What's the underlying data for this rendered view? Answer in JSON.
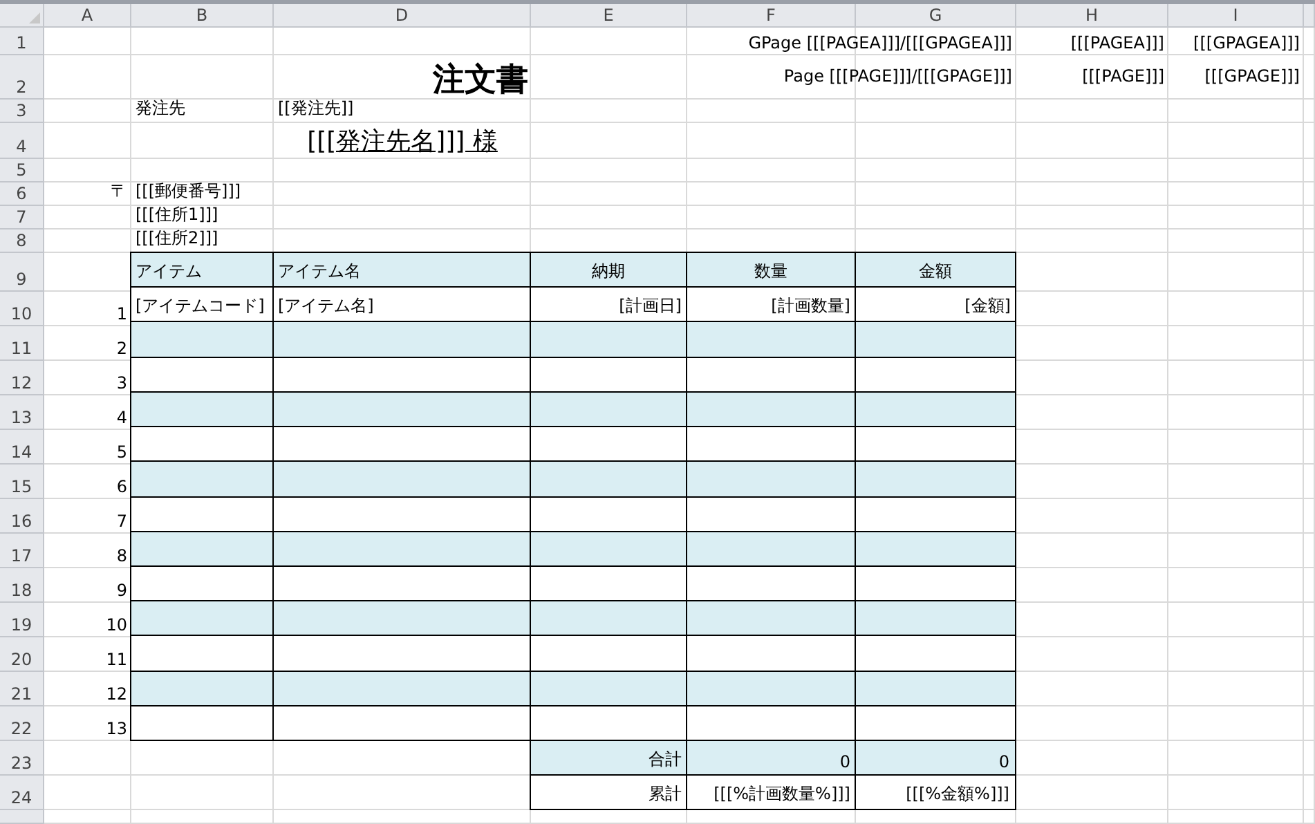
{
  "column_headers": [
    "A",
    "B",
    "D",
    "E",
    "F",
    "G",
    "H",
    "I"
  ],
  "row_numbers": [
    "1",
    "2",
    "3",
    "4",
    "5",
    "6",
    "7",
    "8",
    "9",
    "10",
    "11",
    "12",
    "13",
    "14",
    "15",
    "16",
    "17",
    "18",
    "19",
    "20",
    "21",
    "22",
    "23",
    "24"
  ],
  "gpage": {
    "label": "GPage [[[PAGEA]]]/[[[GPAGEA]]]",
    "current": "[[[PAGEA]]]",
    "total": "[[[GPAGEA]]]"
  },
  "page": {
    "label": "Page [[[PAGE]]]/[[[GPAGE]]]",
    "current": "[[[PAGE]]]",
    "total": "[[[GPAGE]]]"
  },
  "title": "注文書",
  "supplier_label": "発注先",
  "supplier_code": "[[発注先]]",
  "supplier_name": "[[[発注先名]]] 様",
  "postal_mark": "〒",
  "postal_code": "[[[郵便番号]]]",
  "address_1": "[[[住所1]]]",
  "address_2": "[[[住所2]]]",
  "table": {
    "columns": [
      "アイテム",
      "アイテム名",
      "納期",
      "数量",
      "金額"
    ],
    "rows": [
      {
        "number": "1",
        "shaded": false,
        "cells": [
          "[アイテムコード]",
          "[アイテム名]",
          "[計画日]",
          "[計画数量]",
          "[金額]"
        ]
      },
      {
        "number": "2",
        "shaded": true
      },
      {
        "number": "3",
        "shaded": false
      },
      {
        "number": "4",
        "shaded": true
      },
      {
        "number": "5",
        "shaded": false
      },
      {
        "number": "6",
        "shaded": true
      },
      {
        "number": "7",
        "shaded": false
      },
      {
        "number": "8",
        "shaded": true
      },
      {
        "number": "9",
        "shaded": false
      },
      {
        "number": "10",
        "shaded": true
      },
      {
        "number": "11",
        "shaded": false
      },
      {
        "number": "12",
        "shaded": true
      },
      {
        "number": "13",
        "shaded": false
      }
    ]
  },
  "totals": [
    {
      "label": "合計",
      "quantity": "0",
      "amount": "0",
      "shaded": true
    },
    {
      "label": "累計",
      "quantity": "[[[%計画数量%]]]",
      "amount": "[[[%金額%]]]",
      "shaded": false
    }
  ]
}
